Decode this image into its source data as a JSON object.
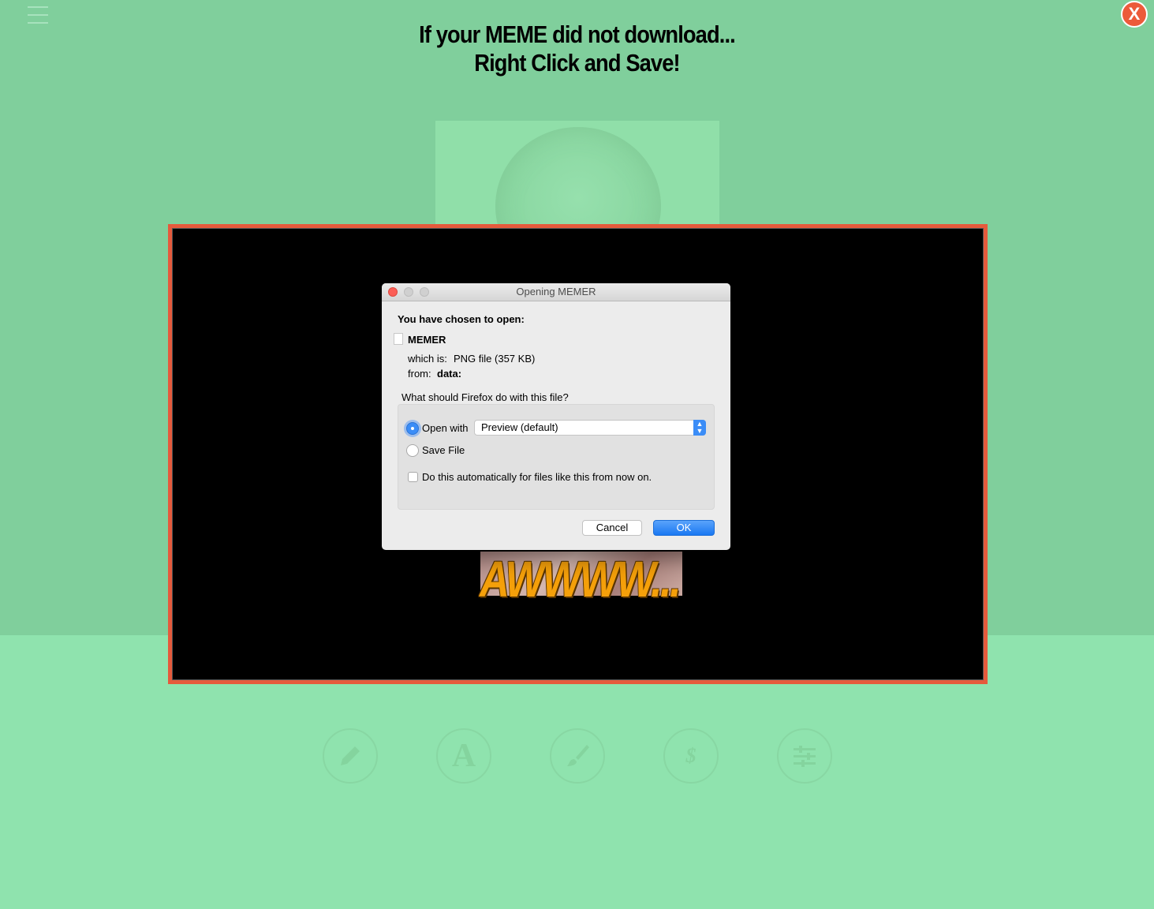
{
  "headline": {
    "line1": "If your MEME did not download...",
    "line2": "Right Click and Save!"
  },
  "close_button": {
    "label": "X",
    "color": "#ec5a3a"
  },
  "meme": {
    "caption": "AWWWW..."
  },
  "dialog": {
    "title": "Opening MEMER",
    "chosen_label": "You have chosen to open:",
    "file_name": "MEMER",
    "which_is_label": "which is:",
    "which_is_value": "PNG file (357 KB)",
    "from_label": "from:",
    "from_value": "data:",
    "question": "What should Firefox do with this file?",
    "open_with_label": "Open with",
    "open_with_selected": "Preview (default)",
    "open_with_checked": true,
    "save_file_label": "Save File",
    "save_file_checked": false,
    "auto_label": "Do this automatically for files like this from now on.",
    "auto_checked": false,
    "cancel_label": "Cancel",
    "ok_label": "OK"
  },
  "toolbar": {
    "tools": [
      {
        "icon": "pencil-icon"
      },
      {
        "icon": "text-a-icon",
        "text": "A"
      },
      {
        "icon": "paintbrush-icon"
      },
      {
        "icon": "dollar-icon",
        "text": "$"
      },
      {
        "icon": "sliders-icon"
      }
    ]
  },
  "colors": {
    "page_top": "#80cf9c",
    "page_bottom": "#8fe3ae",
    "modal_border": "#e55a3c",
    "accent_blue": "#3b8df7",
    "caption_orange": "#f5a00a"
  }
}
